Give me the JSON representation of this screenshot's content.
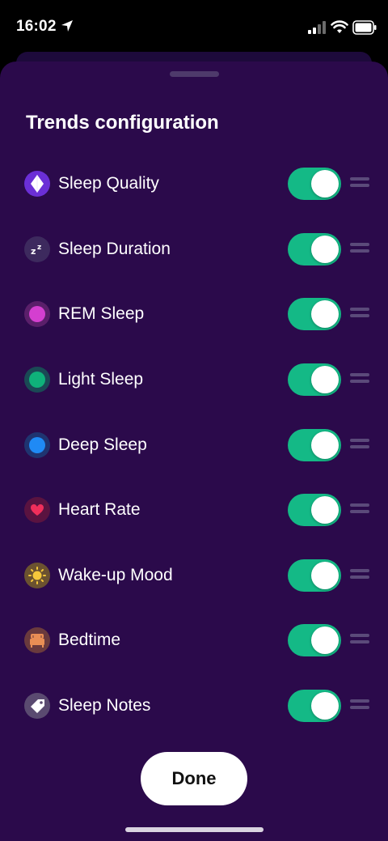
{
  "status_bar": {
    "time": "16:02"
  },
  "sheet": {
    "title": "Trends configuration",
    "items": [
      {
        "label": "Sleep Quality",
        "icon": "sleep-quality-icon",
        "enabled": true
      },
      {
        "label": "Sleep Duration",
        "icon": "sleep-duration-icon",
        "enabled": true
      },
      {
        "label": "REM Sleep",
        "icon": "rem-sleep-icon",
        "enabled": true
      },
      {
        "label": "Light Sleep",
        "icon": "light-sleep-icon",
        "enabled": true
      },
      {
        "label": "Deep Sleep",
        "icon": "deep-sleep-icon",
        "enabled": true
      },
      {
        "label": "Heart Rate",
        "icon": "heart-icon",
        "enabled": true
      },
      {
        "label": "Wake-up Mood",
        "icon": "sun-icon",
        "enabled": true
      },
      {
        "label": "Bedtime",
        "icon": "bed-icon",
        "enabled": true
      },
      {
        "label": "Sleep Notes",
        "icon": "tag-icon",
        "enabled": true
      }
    ],
    "done_label": "Done"
  },
  "colors": {
    "background": "#2b0a4b",
    "toggle_on": "#14b986",
    "rem": "#d43fd0",
    "light": "#0fb27a",
    "deep": "#1f8af5",
    "heart": "#ef2f5b",
    "mood": "#f6c83b",
    "bedtime": "#e98e55"
  }
}
